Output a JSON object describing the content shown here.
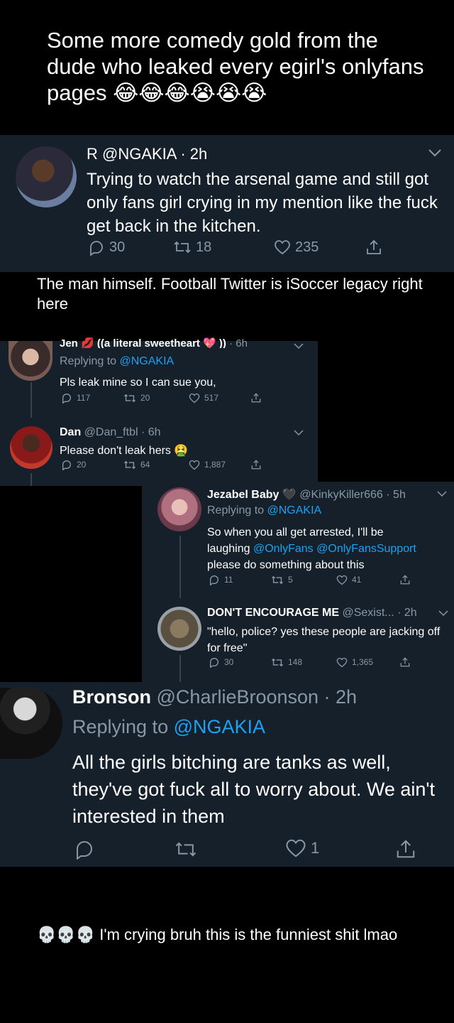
{
  "caption_top": "Some more comedy gold from the dude who leaked every egirl's onlyfans pages 😂😂😂😭😭😭",
  "tweet1": {
    "header": "R @NGAKIA · 2h",
    "text": "Trying to watch the arsenal game and still got only fans girl crying in my mention like the fuck get back in the kitchen.",
    "replies": "30",
    "retweets": "18",
    "likes": "235"
  },
  "caption_mid": "The man himself. Football Twitter is iSoccer legacy right here",
  "tweet_jen": {
    "name": "Jen 💋 ((a literal sweetheart 💖 ))",
    "time": "· 6h",
    "replying_prefix": "Replying to",
    "replying_handle": "@NGAKIA",
    "text": "Pls leak mine so I can sue you,",
    "replies": "117",
    "retweets": "20",
    "likes": "517"
  },
  "tweet_dan": {
    "name": "Dan",
    "handle_time": "@Dan_ftbl · 6h",
    "text": "Please don't leak hers 🤮",
    "replies": "20",
    "retweets": "64",
    "likes": "1,887"
  },
  "tweet_jezabel": {
    "name": "Jezabel Baby 🖤",
    "handle_time": "@KinkyKiller666 · 5h",
    "replying_prefix": "Replying to",
    "replying_handle": "@NGAKIA",
    "text_1": "So when you all get arrested, I'll be",
    "text_2_prefix": "laughing",
    "mention_1": "@OnlyFans",
    "mention_2": "@OnlyFansSupport",
    "text_3": "please do something about this",
    "replies": "11",
    "retweets": "5",
    "likes": "41"
  },
  "tweet_dont": {
    "name": "DON'T ENCOURAGE ME",
    "handle_time": "@Sexist... · 2h",
    "text": "\"hello, police? yes these people are jacking off for free\"",
    "replies": "30",
    "retweets": "148",
    "likes": "1,365"
  },
  "tweet_bronson": {
    "name": "Bronson",
    "handle_time": "@CharlieBroonson · 2h",
    "replying_prefix": "Replying to",
    "replying_handle": "@NGAKIA",
    "text": "All the girls bitching are tanks as well, they've got fuck all to worry about. We ain't interested in them",
    "likes": "1"
  },
  "caption_bottom": "💀💀💀 I'm crying bruh this is the funniest shit lmao",
  "colors": {
    "tweet_bg": "#15202b",
    "muted": "#8899a6",
    "link": "#1da1f2",
    "page_bg": "#000000"
  }
}
